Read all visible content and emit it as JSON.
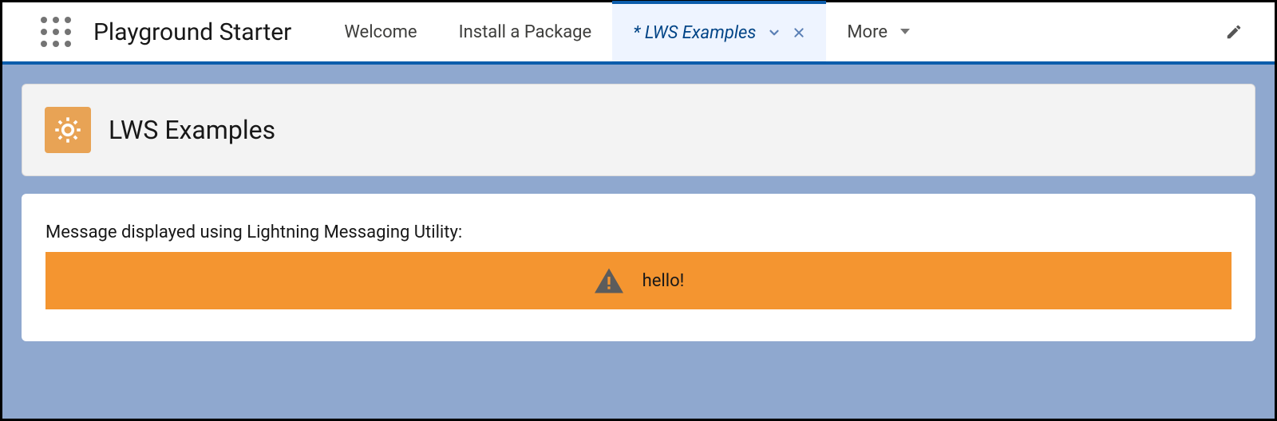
{
  "header": {
    "app_name": "Playground Starter",
    "tabs": [
      {
        "label": "Welcome",
        "active": false
      },
      {
        "label": "Install a Package",
        "active": false
      },
      {
        "label": "LWS Examples",
        "active": true,
        "unsaved": true
      }
    ],
    "more_label": "More"
  },
  "page": {
    "title": "LWS Examples",
    "message_intro": "Message displayed using Lightning Messaging Utility:",
    "alert_text": "hello!"
  },
  "colors": {
    "brand_blue": "#0b5cab",
    "alert_orange": "#f49530",
    "icon_orange": "#e8a355"
  }
}
